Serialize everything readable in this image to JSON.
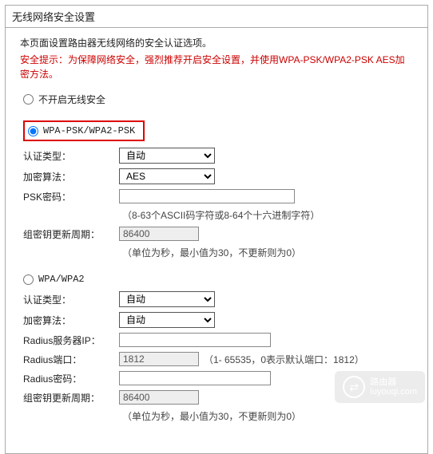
{
  "panel": {
    "title": "无线网络安全设置"
  },
  "intro": "本页面设置路由器无线网络的安全认证选项。",
  "warning": "安全提示：为保障网络安全，强烈推荐开启安全设置，并使用WPA-PSK/WPA2-PSK AES加密方法。",
  "options": {
    "disable": {
      "label": "不开启无线安全",
      "checked": false
    },
    "wpa_psk": {
      "label": "WPA-PSK/WPA2-PSK",
      "checked": true
    },
    "wpa": {
      "label": "WPA/WPA2",
      "checked": false
    }
  },
  "wpa_psk": {
    "auth_label": "认证类型：",
    "auth_value": "自动",
    "encrypt_label": "加密算法：",
    "encrypt_value": "AES",
    "psk_label": "PSK密码：",
    "psk_value": "",
    "psk_hint": "（8-63个ASCII码字符或8-64个十六进制字符）",
    "interval_label": "组密钥更新周期：",
    "interval_value": "86400",
    "interval_hint": "（单位为秒，最小值为30，不更新则为0）"
  },
  "wpa": {
    "auth_label": "认证类型：",
    "auth_value": "自动",
    "encrypt_label": "加密算法：",
    "encrypt_value": "自动",
    "radius_ip_label": "Radius服务器IP：",
    "radius_ip_value": "",
    "radius_port_label": "Radius端口：",
    "radius_port_value": "1812",
    "radius_port_hint": "（1- 65535，0表示默认端口：1812）",
    "radius_pw_label": "Radius密码：",
    "radius_pw_value": "",
    "interval_label": "组密钥更新周期：",
    "interval_value": "86400",
    "interval_hint": "（单位为秒，最小值为30，不更新则为0）"
  },
  "watermark": {
    "title": "路由器",
    "url": "luyouqi.com"
  }
}
